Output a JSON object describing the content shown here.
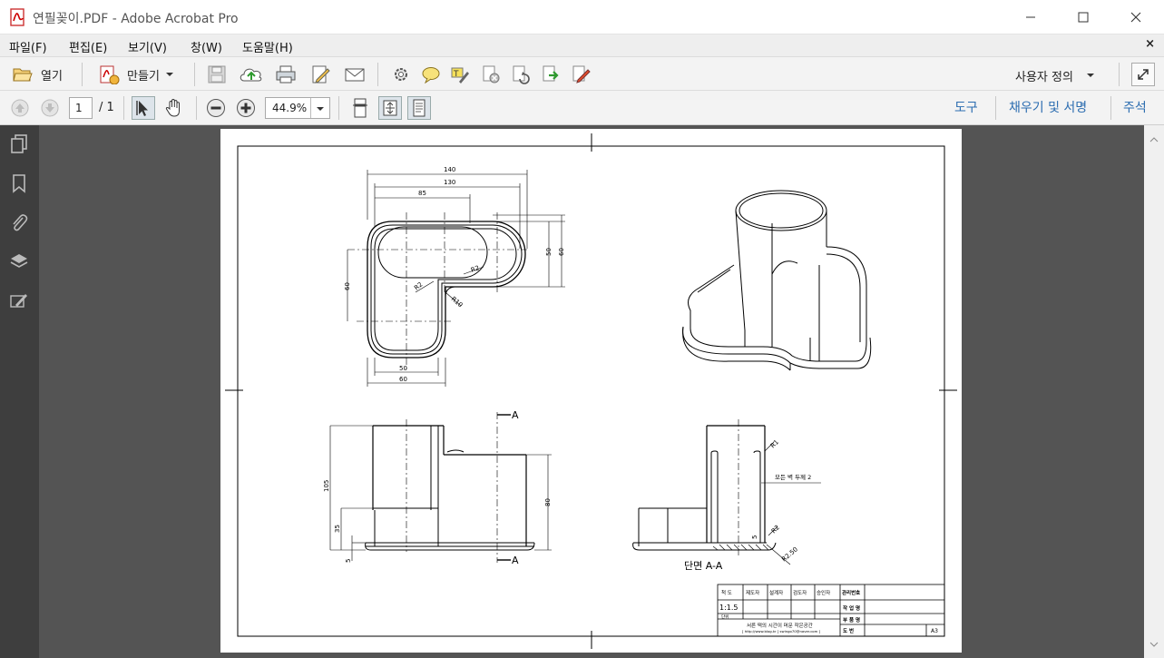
{
  "window": {
    "title": "연필꽂이.PDF - Adobe Acrobat Pro"
  },
  "menu": {
    "items": [
      "파일(F)",
      "편집(E)",
      "보기(V)",
      "창(W)",
      "도움말(H)"
    ],
    "close_doc": "×"
  },
  "toolbar": {
    "open_label": "열기",
    "create_label": "만들기",
    "customize_label": "사용자 정의"
  },
  "nav": {
    "page_current": "1",
    "page_total": "/ 1",
    "zoom": "44.9%",
    "tools_link": "도구",
    "fill_sign_link": "채우기 및 서명",
    "comment_link": "주석"
  },
  "drawing": {
    "top_view_dims": {
      "d140": "140",
      "d130": "130",
      "d85": "85",
      "d50v": "50",
      "d60v": "60",
      "d60h": "60",
      "r2a": "R2",
      "r2b": "R2",
      "r10": "R10",
      "d50": "50",
      "d60": "60"
    },
    "front_view_dims": {
      "d105": "105",
      "d35": "35",
      "d5": "5",
      "d80": "80",
      "section_a": "A"
    },
    "section_view": {
      "r1": "R1",
      "wall_note": "모든 벽 두께 2",
      "r2": "R2",
      "r250": "R2.50",
      "d5": "5",
      "label": "단면 A-A"
    },
    "title_block": {
      "scale_label": "척 도",
      "scale_value": "1:1.5",
      "unit_label": "단위",
      "draft": "제도자",
      "design": "설계자",
      "check": "검도자",
      "approve": "승인자",
      "mgmt_no": "관리번호",
      "work_name": "작 업 명",
      "part_name": "부 품 명",
      "drawing_no": "도    번",
      "company": "서른 떡의 시간이 머문 작은공간",
      "company_sub": "[ http://www.blog.kr ] swingo70@naver.com ]",
      "size": "A3"
    }
  }
}
